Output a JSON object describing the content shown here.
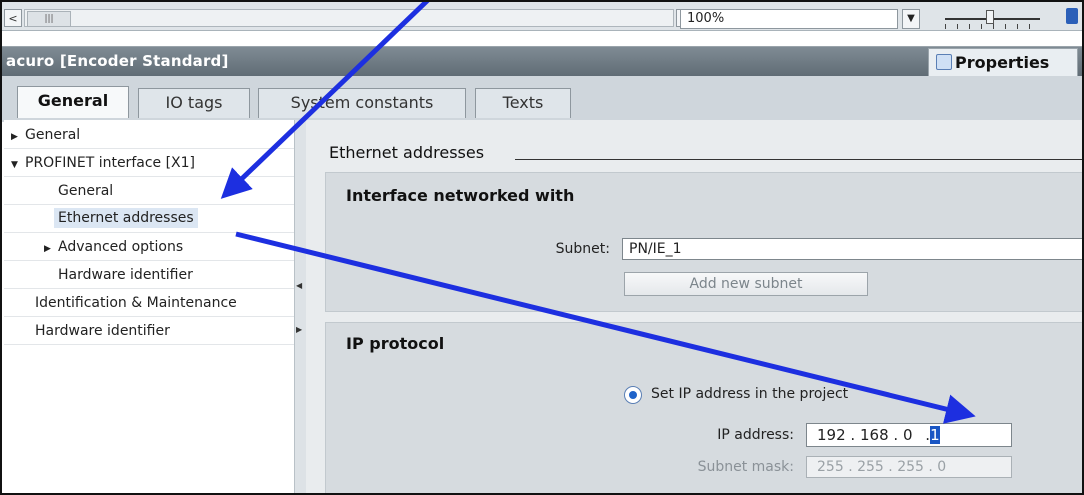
{
  "toolbar": {
    "zoom_value": "100%",
    "scroll_left_symbol": "<",
    "scroll_grip_symbol": "|||",
    "scroll_right_symbol": ">",
    "dropdown_symbol": "▼"
  },
  "title": "acuro [Encoder Standard]",
  "properties_tab": {
    "label": "Properties",
    "icon": "magnifier-icon"
  },
  "tabs": [
    {
      "label": "General",
      "active": true
    },
    {
      "label": "IO tags",
      "active": false
    },
    {
      "label": "System constants",
      "active": false
    },
    {
      "label": "Texts",
      "active": false
    }
  ],
  "tree": {
    "items": [
      {
        "label": "General",
        "expander": "▶"
      },
      {
        "label": "PROFINET interface [X1]",
        "expander": "▼"
      },
      {
        "label": "General"
      },
      {
        "label": "Ethernet addresses",
        "selected": true
      },
      {
        "label": "Advanced options",
        "expander": "▶"
      },
      {
        "label": "Hardware identifier"
      },
      {
        "label": "Identification & Maintenance"
      },
      {
        "label": "Hardware identifier"
      }
    ]
  },
  "main": {
    "section_title": "Ethernet addresses",
    "interface_panel": {
      "title": "Interface networked with",
      "subnet_label": "Subnet:",
      "subnet_value": "PN/IE_1",
      "add_subnet_button": "Add new subnet"
    },
    "ip_panel": {
      "title": "IP protocol",
      "radio_label": "Set IP address in the project",
      "ip_label": "IP address:",
      "ip_octets": [
        "192",
        "168",
        "0",
        "1"
      ],
      "ip_dot": ".",
      "mask_label": "Subnet mask:",
      "mask_octets": [
        "255",
        "255",
        "255",
        "0"
      ]
    }
  },
  "colors": {
    "annotation_arrow": "#1d2fe0",
    "selection": "#1a56c4"
  }
}
